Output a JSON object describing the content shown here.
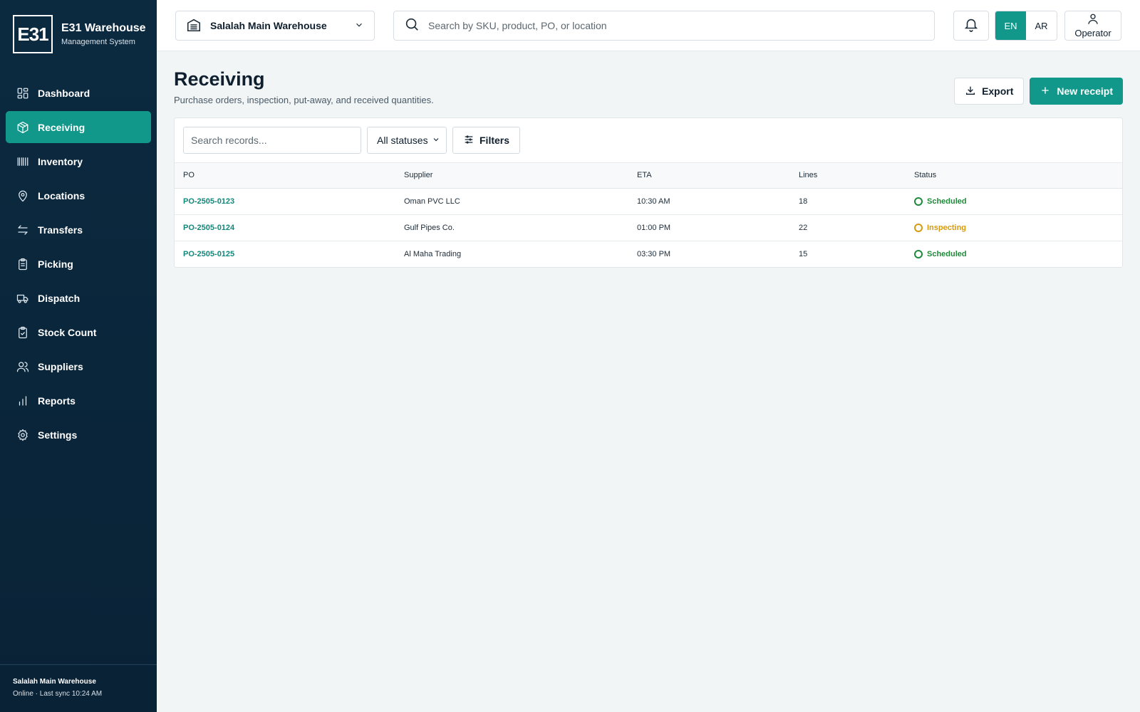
{
  "brand": {
    "logo": "E31",
    "title": "E31 Warehouse",
    "subtitle": "Management System"
  },
  "sidebar": {
    "items": [
      {
        "label": "Dashboard",
        "icon": "dashboard-icon",
        "active": false
      },
      {
        "label": "Receiving",
        "icon": "box-icon",
        "active": true
      },
      {
        "label": "Inventory",
        "icon": "barcode-icon",
        "active": false
      },
      {
        "label": "Locations",
        "icon": "map-pin-icon",
        "active": false
      },
      {
        "label": "Transfers",
        "icon": "transfer-arrows-icon",
        "active": false
      },
      {
        "label": "Picking",
        "icon": "clipboard-list-icon",
        "active": false
      },
      {
        "label": "Dispatch",
        "icon": "truck-icon",
        "active": false
      },
      {
        "label": "Stock Count",
        "icon": "clipboard-check-icon",
        "active": false
      },
      {
        "label": "Suppliers",
        "icon": "users-icon",
        "active": false
      },
      {
        "label": "Reports",
        "icon": "bar-chart-icon",
        "active": false
      },
      {
        "label": "Settings",
        "icon": "gear-icon",
        "active": false
      }
    ],
    "footer": {
      "warehouse": "Salalah Main Warehouse",
      "status": "Online · Last sync 10:24 AM"
    }
  },
  "topbar": {
    "warehouse": "Salalah Main Warehouse",
    "search_placeholder": "Search by SKU, product, PO, or location",
    "lang_en": "EN",
    "lang_ar": "AR",
    "user": "Operator"
  },
  "page": {
    "title": "Receiving",
    "subtitle": "Purchase orders, inspection, put-away, and received quantities.",
    "export_label": "Export",
    "new_label": "New receipt"
  },
  "toolbar": {
    "search_placeholder": "Search records...",
    "status_value": "All statuses",
    "filters_label": "Filters"
  },
  "table": {
    "columns": [
      "PO",
      "Supplier",
      "ETA",
      "Lines",
      "Status"
    ],
    "rows": [
      {
        "po": "PO-2505-0123",
        "supplier": "Oman PVC LLC",
        "eta": "10:30 AM",
        "lines": "18",
        "status": "Scheduled",
        "status_color": "#1f8a3a"
      },
      {
        "po": "PO-2505-0124",
        "supplier": "Gulf Pipes Co.",
        "eta": "01:00 PM",
        "lines": "22",
        "status": "Inspecting",
        "status_color": "#d69a0e"
      },
      {
        "po": "PO-2505-0125",
        "supplier": "Al Maha Trading",
        "eta": "03:30 PM",
        "lines": "15",
        "status": "Scheduled",
        "status_color": "#1f8a3a"
      }
    ]
  },
  "colors": {
    "accent": "#11988a",
    "sidebar": "#0b2a40"
  }
}
